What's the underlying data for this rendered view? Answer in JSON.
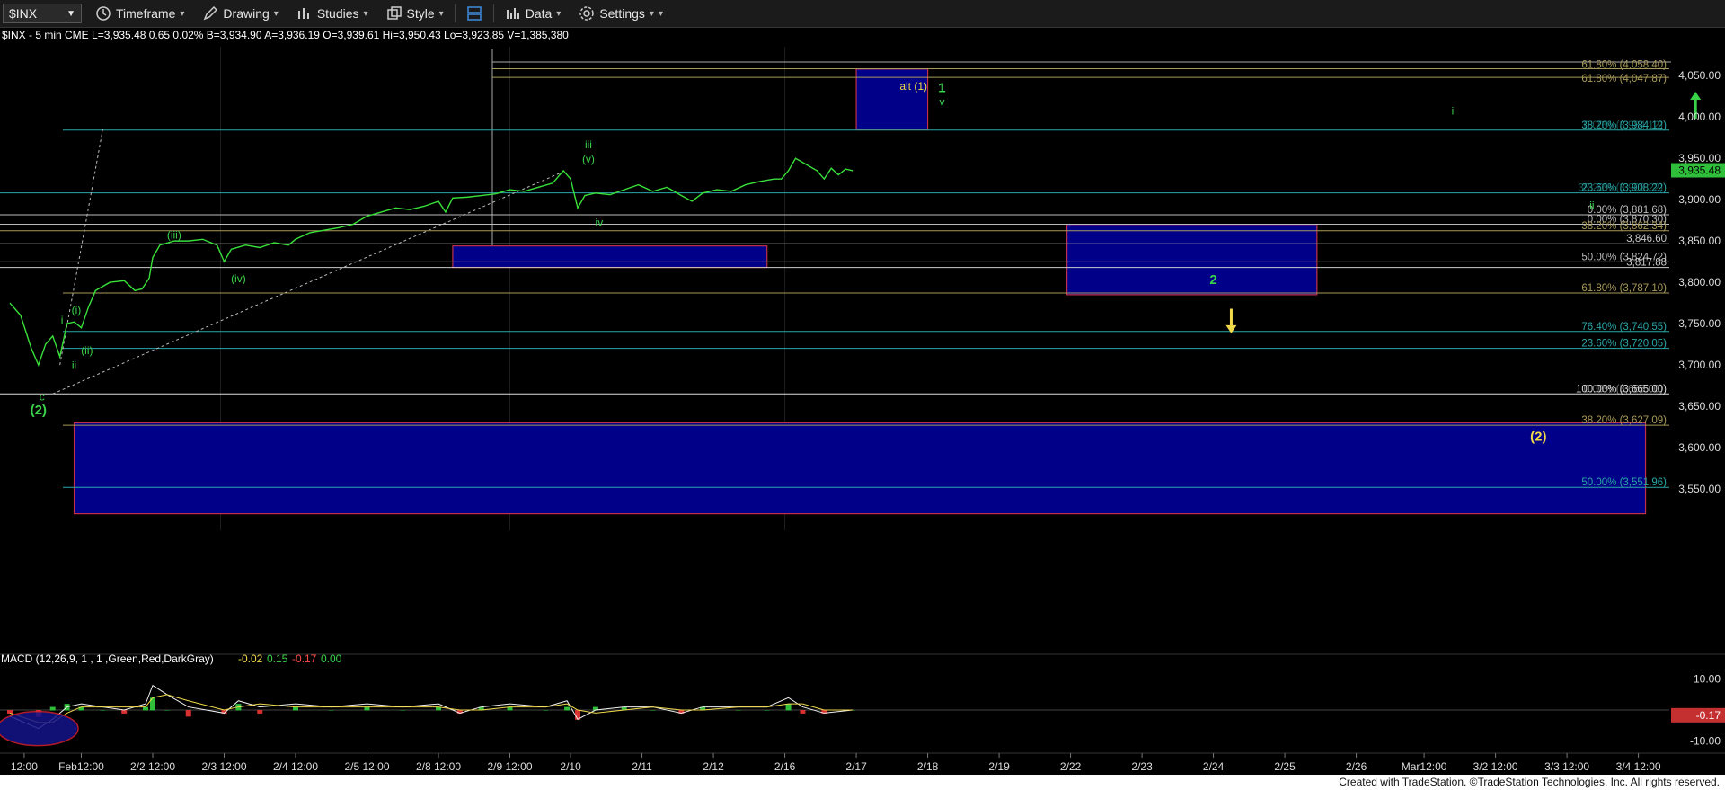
{
  "toolbar": {
    "symbol": "$INX",
    "timeframe": "Timeframe",
    "drawing": "Drawing",
    "studies": "Studies",
    "style": "Style",
    "data": "Data",
    "settings": "Settings"
  },
  "footer": {
    "credit": "Created with TradeStation. ©TradeStation Technologies, Inc. All rights reserved."
  },
  "chart_data": {
    "type": "line",
    "header": "$INX - 5 min  CME  L=3,935.48  0.65  0.02%  B=3,934.90  A=3,936.19  O=3,939.61  Hi=3,950.43  Lo=3,923.85  V=1,385,380",
    "last_price": "3,935.48",
    "ylim": [
      3500,
      4085
    ],
    "y_ticks": [
      "4,050.00",
      "4,000.00",
      "3,950.00",
      "3,900.00",
      "3,850.00",
      "3,800.00",
      "3,750.00",
      "3,700.00",
      "3,650.00",
      "3,600.00",
      "3,550.00"
    ],
    "y_tick_values": [
      4050,
      4000,
      3950,
      3900,
      3850,
      3800,
      3750,
      3700,
      3650,
      3600,
      3550
    ],
    "x_ticks": [
      "12:00",
      "Feb12:00",
      "2/2 12:00",
      "2/3 12:00",
      "2/4 12:00",
      "2/5 12:00",
      "2/8 12:00",
      "2/9 12:00",
      "2/10",
      "2/11",
      "2/12",
      "2/16",
      "2/17",
      "2/18",
      "2/19",
      "2/22",
      "2/23",
      "2/24",
      "2/25",
      "2/26",
      "Mar12:00",
      "3/2 12:00",
      "3/3 12:00",
      "3/4 12:00"
    ],
    "x_tick_index": [
      0.2,
      1,
      2,
      3,
      4,
      5,
      6,
      7,
      7.85,
      8.85,
      9.85,
      10.85,
      11.85,
      12.85,
      13.85,
      14.85,
      15.85,
      16.85,
      17.85,
      18.85,
      19.8,
      20.8,
      21.8,
      22.8
    ],
    "price_series": [
      [
        0.0,
        3775
      ],
      [
        0.15,
        3760
      ],
      [
        0.3,
        3720
      ],
      [
        0.4,
        3700
      ],
      [
        0.5,
        3725
      ],
      [
        0.6,
        3735
      ],
      [
        0.7,
        3710
      ],
      [
        0.8,
        3750
      ],
      [
        0.9,
        3752
      ],
      [
        1.0,
        3745
      ],
      [
        1.1,
        3770
      ],
      [
        1.2,
        3790
      ],
      [
        1.4,
        3800
      ],
      [
        1.6,
        3802
      ],
      [
        1.75,
        3790
      ],
      [
        1.85,
        3792
      ],
      [
        1.95,
        3805
      ],
      [
        2.0,
        3830
      ],
      [
        2.1,
        3845
      ],
      [
        2.3,
        3850
      ],
      [
        2.5,
        3850
      ],
      [
        2.7,
        3852
      ],
      [
        2.9,
        3845
      ],
      [
        3.0,
        3825
      ],
      [
        3.1,
        3840
      ],
      [
        3.3,
        3845
      ],
      [
        3.5,
        3842
      ],
      [
        3.7,
        3848
      ],
      [
        3.9,
        3845
      ],
      [
        4.0,
        3852
      ],
      [
        4.2,
        3860
      ],
      [
        4.4,
        3863
      ],
      [
        4.6,
        3866
      ],
      [
        4.8,
        3870
      ],
      [
        5.0,
        3880
      ],
      [
        5.2,
        3885
      ],
      [
        5.4,
        3890
      ],
      [
        5.6,
        3888
      ],
      [
        5.8,
        3892
      ],
      [
        6.0,
        3898
      ],
      [
        6.1,
        3885
      ],
      [
        6.2,
        3902
      ],
      [
        6.4,
        3903
      ],
      [
        6.6,
        3905
      ],
      [
        6.8,
        3907
      ],
      [
        7.0,
        3912
      ],
      [
        7.2,
        3910
      ],
      [
        7.4,
        3915
      ],
      [
        7.6,
        3920
      ],
      [
        7.75,
        3935
      ],
      [
        7.85,
        3925
      ],
      [
        7.95,
        3890
      ],
      [
        8.05,
        3905
      ],
      [
        8.2,
        3908
      ],
      [
        8.4,
        3906
      ],
      [
        8.6,
        3912
      ],
      [
        8.8,
        3918
      ],
      [
        9.0,
        3910
      ],
      [
        9.2,
        3915
      ],
      [
        9.4,
        3905
      ],
      [
        9.55,
        3898
      ],
      [
        9.7,
        3908
      ],
      [
        9.9,
        3912
      ],
      [
        10.1,
        3910
      ],
      [
        10.3,
        3918
      ],
      [
        10.5,
        3922
      ],
      [
        10.7,
        3925
      ],
      [
        10.8,
        3925
      ],
      [
        10.9,
        3935
      ],
      [
        11.0,
        3950
      ],
      [
        11.1,
        3945
      ],
      [
        11.2,
        3940
      ],
      [
        11.3,
        3935
      ],
      [
        11.4,
        3925
      ],
      [
        11.5,
        3938
      ],
      [
        11.6,
        3930
      ],
      [
        11.7,
        3937
      ],
      [
        11.8,
        3935
      ]
    ],
    "horizontal_levels": [
      {
        "price": 3984.12,
        "label": "38.20% (3,984.12)",
        "alt_label": "0.00% (3,984.12)",
        "color": "#2aa7a7"
      },
      {
        "price": 3908.22,
        "label": "23.60% (3,908.22)",
        "alt_label": "38.20% (3,908.22)",
        "color": "#2aa7a7"
      },
      {
        "price": 3881.68,
        "label": "0.00% (3,881.68)",
        "color": "#bbbbbb"
      },
      {
        "price": 3870.3,
        "label": "0.00% (3,870.30)",
        "color": "#bbbbbb"
      },
      {
        "price": 3862.34,
        "label": "38.20% (3,862.34)",
        "color": "#a89a5a"
      },
      {
        "price": 3846.6,
        "label": "3,846.60",
        "color": "#cccccc"
      },
      {
        "price": 3824.72,
        "label": "50.00% (3,824.72)",
        "color": "#bbbbbb"
      },
      {
        "price": 3817.88,
        "label": "3,817.88",
        "color": "#cccccc"
      },
      {
        "price": 3787.1,
        "label": "61.80% (3,787.10)",
        "color": "#a89a5a"
      },
      {
        "price": 3740.55,
        "label": "76.40% (3,740.55)",
        "color": "#2aa7a7"
      },
      {
        "price": 3720.05,
        "label": "23.60% (3,720.05)",
        "color": "#2aa7a7"
      },
      {
        "price": 3665.0,
        "label": "100.00% (3,665.00)",
        "alt_label": "0.00% (3,665.00)",
        "color": "#dddddd"
      },
      {
        "price": 3627.09,
        "label": "38.20% (3,627.09)",
        "color": "#a89a5a"
      },
      {
        "price": 3551.96,
        "label": "50.00% (3,551.96)",
        "color": "#2aa7a7"
      }
    ],
    "top_fib_labels": [
      "61.80% (4,058.40)",
      "61.80% (4,047.87)"
    ],
    "boxes": [
      {
        "x0": 11.85,
        "x1": 12.85,
        "y0": 3985,
        "y1": 4058
      },
      {
        "x0": 6.2,
        "x1": 10.6,
        "y0": 3818,
        "y1": 3844
      },
      {
        "x0": 14.8,
        "x1": 18.3,
        "y0": 3785,
        "y1": 3870
      },
      {
        "x0": 0.9,
        "x1": 22.9,
        "y0": 3520,
        "y1": 3630
      }
    ],
    "wave_labels": [
      {
        "text": "(2)",
        "x": 0.4,
        "y": 3640,
        "color": "#39d34a"
      },
      {
        "text": "c",
        "x": 0.45,
        "y": 3657,
        "color": "#39d34a"
      },
      {
        "text": "i",
        "x": 0.73,
        "y": 3750,
        "color": "#39d34a"
      },
      {
        "text": "ii",
        "x": 0.9,
        "y": 3695,
        "color": "#39d34a"
      },
      {
        "text": "(i)",
        "x": 0.93,
        "y": 3762,
        "color": "#39d34a"
      },
      {
        "text": "(ii)",
        "x": 1.08,
        "y": 3713,
        "color": "#39d34a"
      },
      {
        "text": "(iii)",
        "x": 2.3,
        "y": 3853,
        "color": "#39d34a"
      },
      {
        "text": "(iv)",
        "x": 3.2,
        "y": 3800,
        "color": "#39d34a"
      },
      {
        "text": "iii",
        "x": 8.1,
        "y": 3962,
        "color": "#39d34a"
      },
      {
        "text": "(v)",
        "x": 8.1,
        "y": 3945,
        "color": "#39d34a"
      },
      {
        "text": "iv",
        "x": 8.25,
        "y": 3868,
        "color": "#39d34a"
      },
      {
        "text": "alt (1)",
        "x": 12.65,
        "y": 4033,
        "color": "#f0d94a"
      },
      {
        "text": "1",
        "x": 13.05,
        "y": 4030,
        "color": "#39d34a"
      },
      {
        "text": "v",
        "x": 13.05,
        "y": 4014,
        "color": "#39d34a"
      },
      {
        "text": "i",
        "x": 20.2,
        "y": 4003,
        "color": "#39d34a"
      },
      {
        "text": "ii",
        "x": 22.15,
        "y": 3889,
        "color": "#39d34a"
      },
      {
        "text": "2",
        "x": 16.85,
        "y": 3798,
        "color": "#39d34a"
      },
      {
        "text": "(2)",
        "x": 21.4,
        "y": 3608,
        "color": "#f0d94a"
      }
    ],
    "arrows": [
      {
        "x": 23.6,
        "y_from": 3998,
        "y_to": 4022,
        "color": "#39d34a"
      },
      {
        "x": 17.1,
        "y_from": 3768,
        "y_to": 3747,
        "color": "#f0d94a"
      }
    ],
    "macd": {
      "label": "MACD (12,26,9, 1 , 1 ,Green,Red,DarkGray)",
      "value_1": "-0.02",
      "value_2": "0.15",
      "value_3": "-0.17",
      "value_4": "0.00",
      "last": "-0.17",
      "ylim": [
        -14,
        14
      ],
      "y_ticks": [
        "10.00",
        "-10.00"
      ],
      "y_tick_values": [
        10,
        -10
      ],
      "macd_series": [
        [
          0,
          -2
        ],
        [
          0.4,
          -6
        ],
        [
          0.6,
          -3
        ],
        [
          0.8,
          1
        ],
        [
          1.0,
          2
        ],
        [
          1.3,
          1
        ],
        [
          1.6,
          0
        ],
        [
          1.9,
          2
        ],
        [
          2.0,
          8
        ],
        [
          2.2,
          5
        ],
        [
          2.5,
          1
        ],
        [
          3.0,
          -1
        ],
        [
          3.2,
          3
        ],
        [
          3.5,
          1
        ],
        [
          4.0,
          2
        ],
        [
          4.5,
          1
        ],
        [
          5.0,
          2
        ],
        [
          5.5,
          1
        ],
        [
          6.0,
          2
        ],
        [
          6.3,
          -1
        ],
        [
          6.6,
          1
        ],
        [
          7.0,
          2
        ],
        [
          7.5,
          1
        ],
        [
          7.8,
          3
        ],
        [
          7.95,
          -3
        ],
        [
          8.2,
          0
        ],
        [
          8.6,
          1
        ],
        [
          9.0,
          1
        ],
        [
          9.4,
          -1
        ],
        [
          9.7,
          1
        ],
        [
          10.2,
          1
        ],
        [
          10.6,
          1
        ],
        [
          10.9,
          4
        ],
        [
          11.1,
          1
        ],
        [
          11.4,
          -1
        ],
        [
          11.8,
          0
        ]
      ],
      "signal_series": [
        [
          0,
          -1
        ],
        [
          0.4,
          -4
        ],
        [
          0.6,
          -4
        ],
        [
          0.8,
          -1
        ],
        [
          1.0,
          1
        ],
        [
          1.3,
          1
        ],
        [
          1.6,
          1
        ],
        [
          1.9,
          1
        ],
        [
          2.0,
          4
        ],
        [
          2.2,
          5
        ],
        [
          2.5,
          3
        ],
        [
          3.0,
          0
        ],
        [
          3.2,
          1
        ],
        [
          3.5,
          2
        ],
        [
          4.0,
          1
        ],
        [
          4.5,
          1
        ],
        [
          5.0,
          1
        ],
        [
          5.5,
          1
        ],
        [
          6.0,
          1
        ],
        [
          6.3,
          0
        ],
        [
          6.6,
          0
        ],
        [
          7.0,
          1
        ],
        [
          7.5,
          1
        ],
        [
          7.8,
          2
        ],
        [
          7.95,
          0
        ],
        [
          8.2,
          -1
        ],
        [
          8.6,
          0
        ],
        [
          9.0,
          1
        ],
        [
          9.4,
          0
        ],
        [
          9.7,
          0
        ],
        [
          10.2,
          1
        ],
        [
          10.6,
          1
        ],
        [
          10.9,
          2
        ],
        [
          11.1,
          2
        ],
        [
          11.4,
          0
        ],
        [
          11.8,
          0
        ]
      ]
    }
  }
}
